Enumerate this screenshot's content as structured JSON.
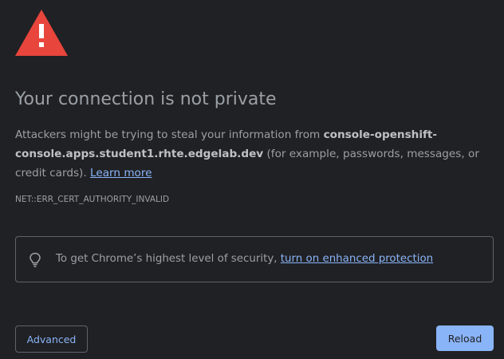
{
  "icons": {
    "warning": "warning-triangle-icon",
    "bulb": "lightbulb-icon"
  },
  "colors": {
    "background": "#202124",
    "text": "#9aa0a6",
    "accent": "#8ab4f8",
    "warning": "#e8453c",
    "border": "#5f6368"
  },
  "page": {
    "title": "Your connection is not private",
    "body_intro": "Attackers might be trying to steal your information from ",
    "host": "console-openshift-console.apps.student1.rhte.edgelab.dev",
    "body_tail": " (for example, passwords, messages, or credit cards). ",
    "learn_more": "Learn more",
    "error_code": "NET::ERR_CERT_AUTHORITY_INVALID"
  },
  "enhanced": {
    "text": "To get Chrome’s highest level of security, ",
    "link": "turn on enhanced protection"
  },
  "buttons": {
    "advanced": "Advanced",
    "reload": "Reload"
  }
}
